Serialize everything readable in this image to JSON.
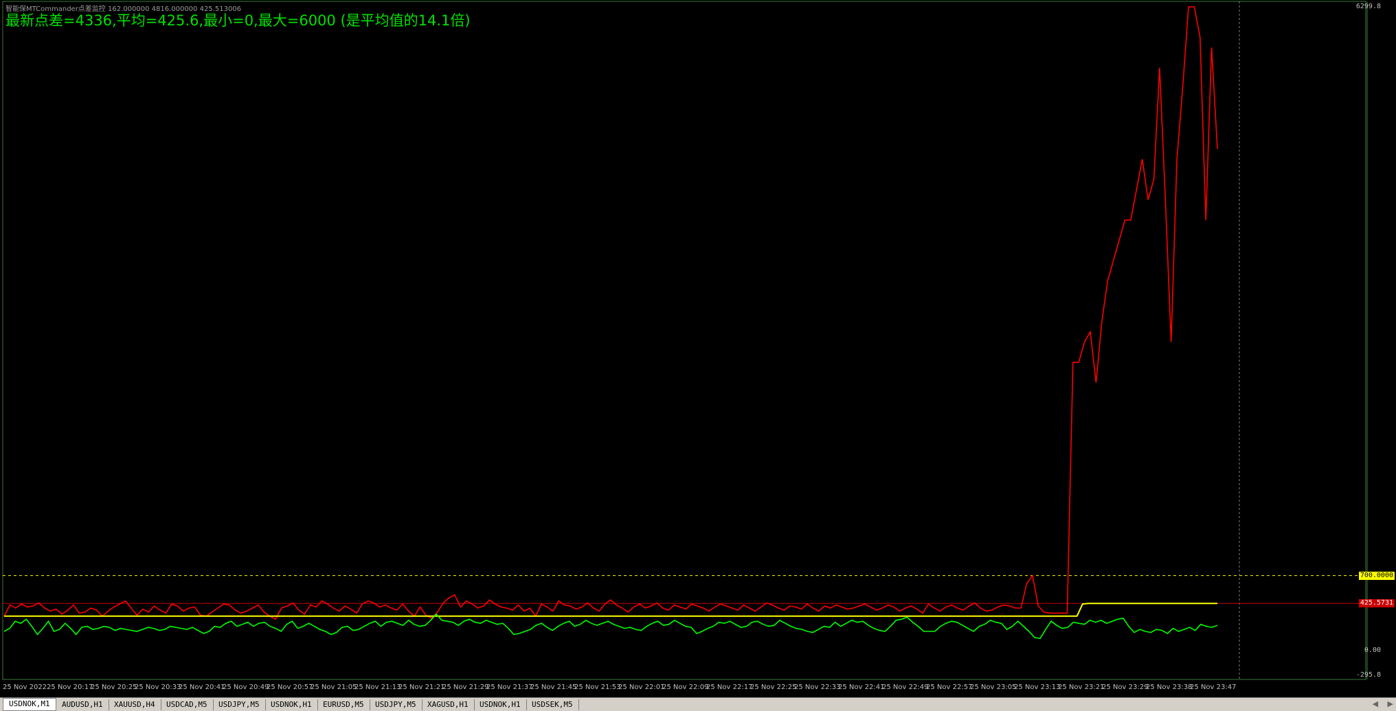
{
  "indicator": {
    "label": "智能保MTCommander点差监控 162.000000 4816.000000 425.513006"
  },
  "headline": "最新点差=4336,平均=425.6,最小=0,最大=6000 (是平均值的14.1倍)",
  "price_axis": {
    "top_label": "6299.8",
    "label_0": "0.00",
    "label_neg": "-295.8",
    "level_700": "700.0000",
    "level_avg": "425.5731"
  },
  "colors": {
    "background": "#000000",
    "spread_line": "#ff0000",
    "average_line": "#ffff00",
    "green_line": "#00ff00",
    "headline": "#00e000",
    "level_700": "#ffff00",
    "level_avg": "#ff0000"
  },
  "time_axis": {
    "labels": [
      "25 Nov 2022",
      "25 Nov 20:17",
      "25 Nov 20:25",
      "25 Nov 20:33",
      "25 Nov 20:41",
      "25 Nov 20:49",
      "25 Nov 20:57",
      "25 Nov 21:05",
      "25 Nov 21:13",
      "25 Nov 21:21",
      "25 Nov 21:29",
      "25 Nov 21:37",
      "25 Nov 21:45",
      "25 Nov 21:53",
      "25 Nov 22:01",
      "25 Nov 22:09",
      "25 Nov 22:17",
      "25 Nov 22:25",
      "25 Nov 22:33",
      "25 Nov 22:41",
      "25 Nov 22:49",
      "25 Nov 22:57",
      "25 Nov 23:05",
      "25 Nov 23:13",
      "25 Nov 23:21",
      "25 Nov 23:29",
      "25 Nov 23:38",
      "25 Nov 23:47"
    ]
  },
  "tabs": [
    {
      "label": "USDNOK,M1",
      "active": true
    },
    {
      "label": "AUDUSD,H1",
      "active": false
    },
    {
      "label": "XAUUSD,H4",
      "active": false
    },
    {
      "label": "USDCAD,M5",
      "active": false
    },
    {
      "label": "USDJPY,M5",
      "active": false
    },
    {
      "label": "USDNOK,H1",
      "active": false
    },
    {
      "label": "EURUSD,M5",
      "active": false
    },
    {
      "label": "USDJPY,M5",
      "active": false
    },
    {
      "label": "XAGUSD,H1",
      "active": false
    },
    {
      "label": "USDNOK,H1",
      "active": false
    },
    {
      "label": "USDSEK,M5",
      "active": false
    }
  ],
  "chart_data": {
    "type": "line",
    "ylim": [
      -295.8,
      6299.8
    ],
    "reference_levels": [
      700,
      425.5731
    ],
    "series": [
      {
        "color": "#ff0000",
        "values": [
          300,
          410,
          380,
          420,
          390,
          400,
          430,
          380,
          350,
          370,
          320,
          360,
          410,
          330,
          340,
          380,
          360,
          300,
          350,
          390,
          420,
          450,
          380,
          310,
          370,
          340,
          400,
          360,
          330,
          420,
          400,
          350,
          380,
          390,
          310,
          300,
          340,
          380,
          420,
          410,
          360,
          330,
          350,
          380,
          410,
          340,
          300,
          270,
          380,
          400,
          430,
          360,
          320,
          410,
          390,
          450,
          420,
          380,
          350,
          400,
          370,
          330,
          420,
          450,
          430,
          390,
          410,
          380,
          360,
          420,
          350,
          300,
          390,
          310,
          280,
          340,
          430,
          480,
          510,
          390,
          450,
          420,
          380,
          400,
          460,
          420,
          390,
          380,
          360,
          410,
          350,
          380,
          300,
          420,
          390,
          350,
          450,
          410,
          400,
          370,
          390,
          430,
          380,
          350,
          420,
          460,
          410,
          380,
          340,
          390,
          420,
          380,
          400,
          430,
          380,
          360,
          410,
          390,
          370,
          420,
          400,
          380,
          350,
          390,
          420,
          400,
          380,
          360,
          410,
          380,
          350,
          390,
          430,
          410,
          380,
          360,
          400,
          390,
          370,
          420,
          380,
          350,
          400,
          380,
          410,
          390,
          370,
          380,
          400,
          420,
          390,
          360,
          380,
          410,
          390,
          350,
          380,
          400,
          370,
          330,
          420,
          380,
          350,
          390,
          410,
          380,
          360,
          400,
          430,
          380,
          350,
          360,
          390,
          410,
          400,
          380,
          380,
          620,
          700,
          400,
          340,
          330,
          330,
          330,
          330,
          2800,
          2800,
          3000,
          3100,
          2600,
          3200,
          3600,
          3800,
          4000,
          4200,
          4200,
          4500,
          4800,
          4400,
          4600,
          5700,
          4400,
          3000,
          4800,
          5500,
          6300,
          6300,
          6000,
          4200,
          5900,
          4900
        ]
      },
      {
        "color": "#ffff00",
        "values": [
          300,
          300,
          300,
          300,
          300,
          300,
          300,
          300,
          300,
          300,
          300,
          300,
          300,
          300,
          300,
          300,
          300,
          300,
          300,
          300,
          300,
          300,
          300,
          300,
          300,
          300,
          300,
          300,
          300,
          300,
          300,
          300,
          300,
          300,
          300,
          300,
          300,
          300,
          300,
          300,
          300,
          300,
          300,
          300,
          300,
          300,
          300,
          300,
          300,
          300,
          300,
          300,
          300,
          300,
          300,
          300,
          300,
          300,
          300,
          300,
          300,
          300,
          300,
          300,
          300,
          300,
          300,
          300,
          300,
          300,
          300,
          300,
          300,
          300,
          300,
          300,
          300,
          300,
          300,
          300,
          300,
          300,
          300,
          300,
          300,
          300,
          300,
          300,
          300,
          300,
          300,
          300,
          300,
          300,
          300,
          300,
          300,
          300,
          300,
          300,
          300,
          300,
          300,
          300,
          300,
          300,
          300,
          300,
          300,
          300,
          300,
          300,
          300,
          300,
          300,
          300,
          300,
          300,
          300,
          300,
          300,
          300,
          300,
          300,
          300,
          300,
          300,
          300,
          300,
          300,
          300,
          300,
          300,
          300,
          300,
          300,
          300,
          300,
          300,
          300,
          300,
          300,
          300,
          300,
          300,
          300,
          300,
          300,
          300,
          300,
          300,
          300,
          300,
          300,
          300,
          300,
          300,
          300,
          300,
          300,
          300,
          300,
          300,
          300,
          300,
          300,
          300,
          300,
          300,
          300,
          300,
          300,
          300,
          300,
          300,
          300,
          300,
          300,
          300,
          300,
          300,
          300,
          300,
          300,
          300,
          300,
          300,
          300,
          300,
          300,
          300,
          300,
          420,
          425,
          425,
          425,
          425,
          425,
          425,
          425,
          425,
          425,
          425,
          425,
          425,
          425,
          425,
          425,
          425,
          425,
          425,
          425,
          425,
          425,
          425,
          425,
          425
        ]
      },
      {
        "color": "#00ff00",
        "values": [
          150,
          180,
          250,
          230,
          270,
          200,
          120,
          180,
          250,
          150,
          170,
          230,
          180,
          120,
          190,
          200,
          170,
          180,
          200,
          190,
          160,
          180,
          170,
          160,
          150,
          170,
          190,
          180,
          160,
          170,
          200,
          190,
          180,
          170,
          190,
          160,
          130,
          150,
          200,
          190,
          230,
          250,
          200,
          220,
          240,
          200,
          230,
          240,
          200,
          180,
          150,
          220,
          250,
          180,
          200,
          230,
          200,
          170,
          150,
          120,
          140,
          190,
          200,
          160,
          170,
          200,
          230,
          250,
          200,
          240,
          250,
          230,
          210,
          260,
          220,
          200,
          210,
          260,
          320,
          260,
          250,
          240,
          210,
          250,
          270,
          240,
          230,
          260,
          240,
          220,
          230,
          180,
          120,
          130,
          150,
          170,
          210,
          230,
          190,
          160,
          200,
          230,
          250,
          200,
          220,
          260,
          230,
          210,
          230,
          250,
          220,
          200,
          180,
          190,
          170,
          160,
          200,
          230,
          250,
          210,
          220,
          260,
          230,
          200,
          190,
          130,
          150,
          180,
          200,
          240,
          230,
          250,
          220,
          190,
          200,
          240,
          250,
          220,
          200,
          210,
          260,
          230,
          200,
          180,
          170,
          150,
          140,
          170,
          200,
          190,
          240,
          200,
          230,
          260,
          240,
          250,
          210,
          180,
          160,
          150,
          200,
          260,
          270,
          290,
          240,
          200,
          150,
          150,
          150,
          200,
          230,
          250,
          240,
          210,
          180,
          150,
          200,
          220,
          260,
          240,
          230,
          170,
          200,
          250,
          200,
          150,
          90,
          80,
          170,
          250,
          210,
          180,
          190,
          240,
          230,
          220,
          260,
          240,
          260,
          230,
          250,
          270,
          280,
          200,
          140,
          170,
          150,
          140,
          170,
          160,
          130,
          180,
          150,
          170,
          190,
          160,
          220,
          200,
          190,
          210
        ]
      }
    ]
  }
}
